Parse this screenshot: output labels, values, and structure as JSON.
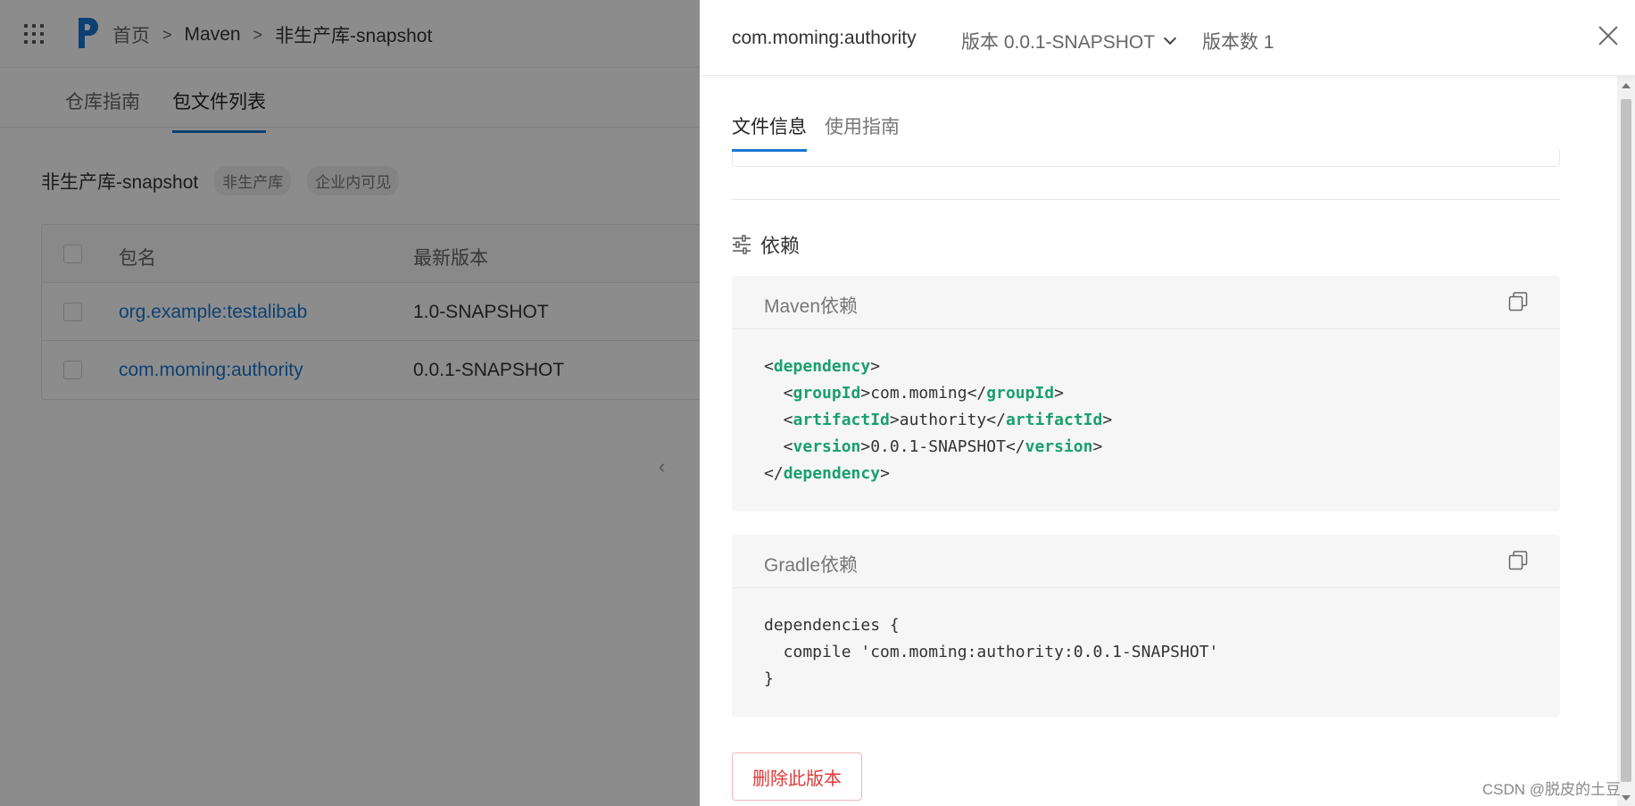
{
  "breadcrumb": {
    "home": "首页",
    "section": "Maven",
    "repo": "非生产库-snapshot"
  },
  "tabs": {
    "guide": "仓库指南",
    "files": "包文件列表"
  },
  "repo": {
    "name": "非生产库-snapshot",
    "tag_env": "非生产库",
    "tag_visibility": "企业内可见"
  },
  "table": {
    "headers": {
      "name": "包名",
      "version": "最新版本"
    },
    "rows": [
      {
        "name": "org.example:testalibab",
        "version": "1.0-SNAPSHOT"
      },
      {
        "name": "com.moming:authority",
        "version": "0.0.1-SNAPSHOT"
      }
    ]
  },
  "drawer": {
    "package": "com.moming:authority",
    "version_label": "版本 0.0.1-SNAPSHOT",
    "version_count": "版本数 1",
    "tabs": {
      "info": "文件信息",
      "usage": "使用指南"
    },
    "deps_title": "依赖",
    "maven": {
      "title": "Maven依赖",
      "tag_dependency": "dependency",
      "tag_group": "groupId",
      "val_group": "com.moming",
      "tag_artifact": "artifactId",
      "val_artifact": "authority",
      "tag_version": "version",
      "val_version": "0.0.1-SNAPSHOT"
    },
    "gradle": {
      "title": "Gradle依赖",
      "line1": "dependencies {",
      "line2": "  compile 'com.moming:authority:0.0.1-SNAPSHOT'",
      "line3": "}"
    },
    "delete_label": "删除此版本"
  },
  "pager_prev": "‹",
  "watermark": "CSDN @脱皮的土豆",
  "colors": {
    "accent": "#1677d2",
    "xml_tag": "#1aa06d",
    "danger": "#e03a3a"
  }
}
